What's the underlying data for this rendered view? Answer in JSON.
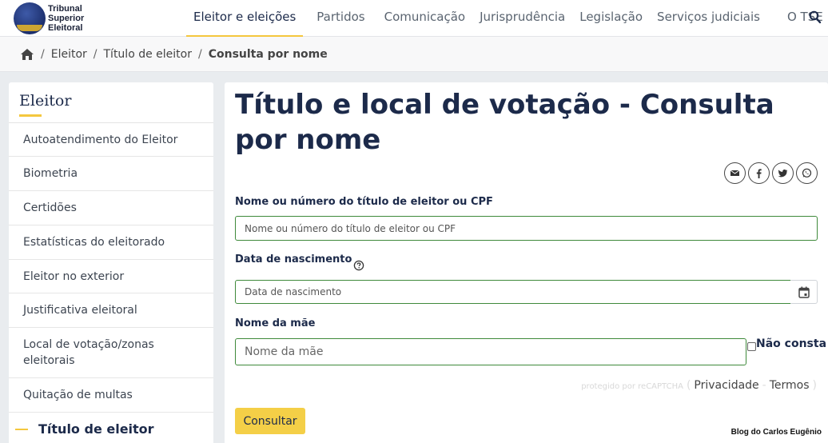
{
  "header": {
    "logo_text": [
      "Tribunal",
      "Superior",
      "Eleitoral"
    ],
    "nav": [
      {
        "label": "Eleitor e eleições",
        "active": true
      },
      {
        "label": "Partidos",
        "active": false
      },
      {
        "label": "Comunicação",
        "active": false
      },
      {
        "label": "Jurisprudência",
        "active": false
      },
      {
        "label": "Legislação",
        "active": false
      },
      {
        "label": "Serviços judiciais",
        "active": false
      },
      {
        "label": "O TSE",
        "active": false
      }
    ],
    "search_icon": "search-icon"
  },
  "breadcrumb": {
    "home_icon": "home-icon",
    "items": [
      "Eleitor",
      "Título de eleitor"
    ],
    "current": "Consulta por nome"
  },
  "sidebar": {
    "title": "Eleitor",
    "items": [
      "Autoatendimento do Eleitor",
      "Biometria",
      "Certidões",
      "Estatísticas do eleitorado",
      "Eleitor no exterior",
      "Justificativa eleitoral",
      "Local de votação/zonas eleitorais",
      "Quitação de multas"
    ],
    "active_item": "Título de eleitor"
  },
  "main": {
    "title": "Título e local de votação - Consulta por nome",
    "share_icons": [
      "email-icon",
      "facebook-icon",
      "twitter-icon",
      "whatsapp-icon"
    ],
    "form": {
      "name_label": "Nome ou número do título de eleitor ou CPF",
      "name_placeholder": "Nome ou número do título de eleitor ou CPF",
      "birth_label": "Data de nascimento",
      "birth_placeholder": "Data de nascimento",
      "mother_label": "Nome da mãe",
      "mother_placeholder": "Nome da mãe",
      "not_listed_label": "Não consta",
      "submit_label": "Consultar"
    },
    "recaptcha": {
      "note": "protegido por reCAPTCHA",
      "privacy": "Privacidade",
      "terms": "Termos"
    }
  },
  "watermark": "Blog do Carlos Eugênio",
  "colors": {
    "accent": "#f4c73e",
    "navy": "#1c2a4a",
    "field_border": "#3f8a3b"
  }
}
